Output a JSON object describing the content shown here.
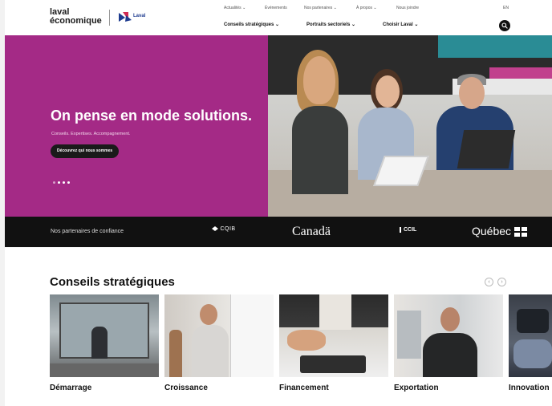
{
  "brand": {
    "logo_line1": "laval",
    "logo_line2": "économique",
    "city_mark": "Laval",
    "colors": {
      "magenta": "#a42a86",
      "dark": "#111111",
      "teal": "#2a8c95"
    }
  },
  "topnav": [
    "Actualités ⌄",
    "Événements",
    "Nos partenaires ⌄",
    "À propos ⌄",
    "Nous joindre",
    "EN"
  ],
  "mainnav": [
    "Conseils stratégiques ⌄",
    "Portraits sectoriels ⌄",
    "Choisir Laval ⌄"
  ],
  "search": {
    "icon": "search-icon"
  },
  "hero": {
    "title": "On pense en mode solutions.",
    "subtitle": "Conseils. Expertises. Accompagnement.",
    "cta": "Découvrez qui nous sommes",
    "slides_count": 4
  },
  "partners": {
    "label": "Nos partenaires de confiance",
    "logos": [
      "CQIB",
      "Canadä",
      "CCIL",
      "Québec"
    ]
  },
  "strategic": {
    "title": "Conseils stratégiques",
    "prev_icon": "chevron-left-icon",
    "next_icon": "chevron-right-icon",
    "cards": [
      "Démarrage",
      "Croissance",
      "Financement",
      "Exportation",
      "Innovation"
    ]
  }
}
